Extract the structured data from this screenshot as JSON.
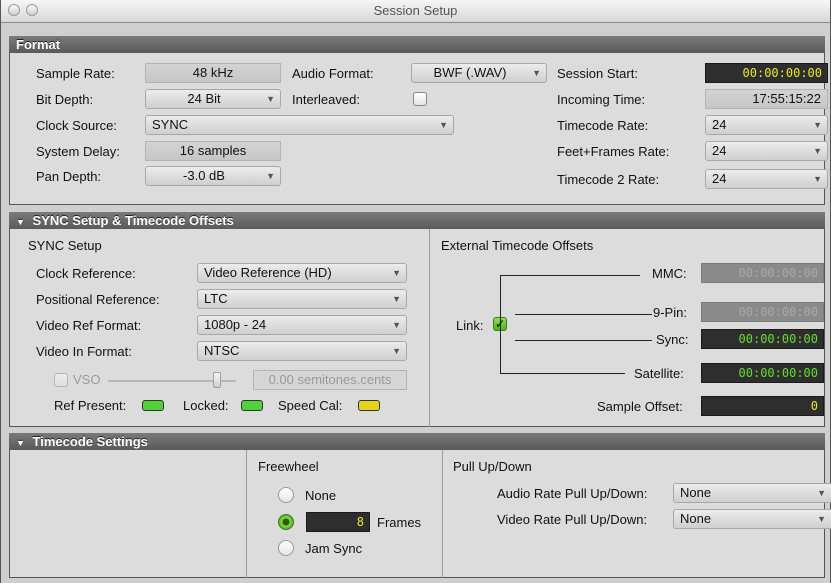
{
  "window": {
    "title": "Session Setup"
  },
  "format": {
    "header": "Format",
    "sample_rate_label": "Sample Rate:",
    "sample_rate": "48 kHz",
    "bit_depth_label": "Bit Depth:",
    "bit_depth": "24 Bit",
    "clock_source_label": "Clock Source:",
    "clock_source": "SYNC",
    "system_delay_label": "System Delay:",
    "system_delay": "16 samples",
    "pan_depth_label": "Pan Depth:",
    "pan_depth": "-3.0 dB",
    "audio_format_label": "Audio Format:",
    "audio_format": "BWF (.WAV)",
    "interleaved_label": "Interleaved:",
    "interleaved": false,
    "session_start_label": "Session Start:",
    "session_start": "00:00:00:00",
    "incoming_time_label": "Incoming Time:",
    "incoming_time": "17:55:15:22",
    "timecode_rate_label": "Timecode Rate:",
    "timecode_rate": "24",
    "feet_frames_rate_label": "Feet+Frames Rate:",
    "feet_frames_rate": "24",
    "timecode2_rate_label": "Timecode 2 Rate:",
    "timecode2_rate": "24"
  },
  "sync": {
    "header": "SYNC Setup & Timecode Offsets",
    "setup_title": "SYNC Setup",
    "clock_reference_label": "Clock Reference:",
    "clock_reference": "Video Reference (HD)",
    "positional_reference_label": "Positional Reference:",
    "positional_reference": "LTC",
    "video_ref_format_label": "Video Ref Format:",
    "video_ref_format": "1080p - 24",
    "video_in_format_label": "Video In Format:",
    "video_in_format": "NTSC",
    "vso_label": "VSO",
    "vso_value": "0.00 semitones.cents",
    "ref_present_label": "Ref Present:",
    "locked_label": "Locked:",
    "speed_cal_label": "Speed Cal:",
    "ref_present_color": "#4fd13a",
    "locked_color": "#4fd13a",
    "speed_cal_color": "#e6d21c",
    "offsets_title": "External Timecode Offsets",
    "link_label": "Link:",
    "link_checked": true,
    "link_check_glyph": "✓",
    "mmc_label": "MMC:",
    "mmc": "00:00:00:00",
    "ninepin_label": "9-Pin:",
    "ninepin": "00:00:00:00",
    "sync_label": "Sync:",
    "sync_offset": "00:00:00:00",
    "satellite_label": "Satellite:",
    "satellite": "00:00:00:00",
    "sample_offset_label": "Sample Offset:",
    "sample_offset": "0"
  },
  "timecode": {
    "header": "Timecode Settings",
    "freewheel_title": "Freewheel",
    "none_label": "None",
    "frames_value": "8",
    "frames_label": "Frames",
    "jam_sync_label": "Jam Sync",
    "selected": "Frames",
    "pull_title": "Pull Up/Down",
    "audio_pull_label": "Audio Rate Pull Up/Down:",
    "audio_pull": "None",
    "video_pull_label": "Video Rate Pull Up/Down:",
    "video_pull": "None"
  },
  "icons": {
    "disclosure": "▼",
    "dropdown_arrow": "▼"
  }
}
